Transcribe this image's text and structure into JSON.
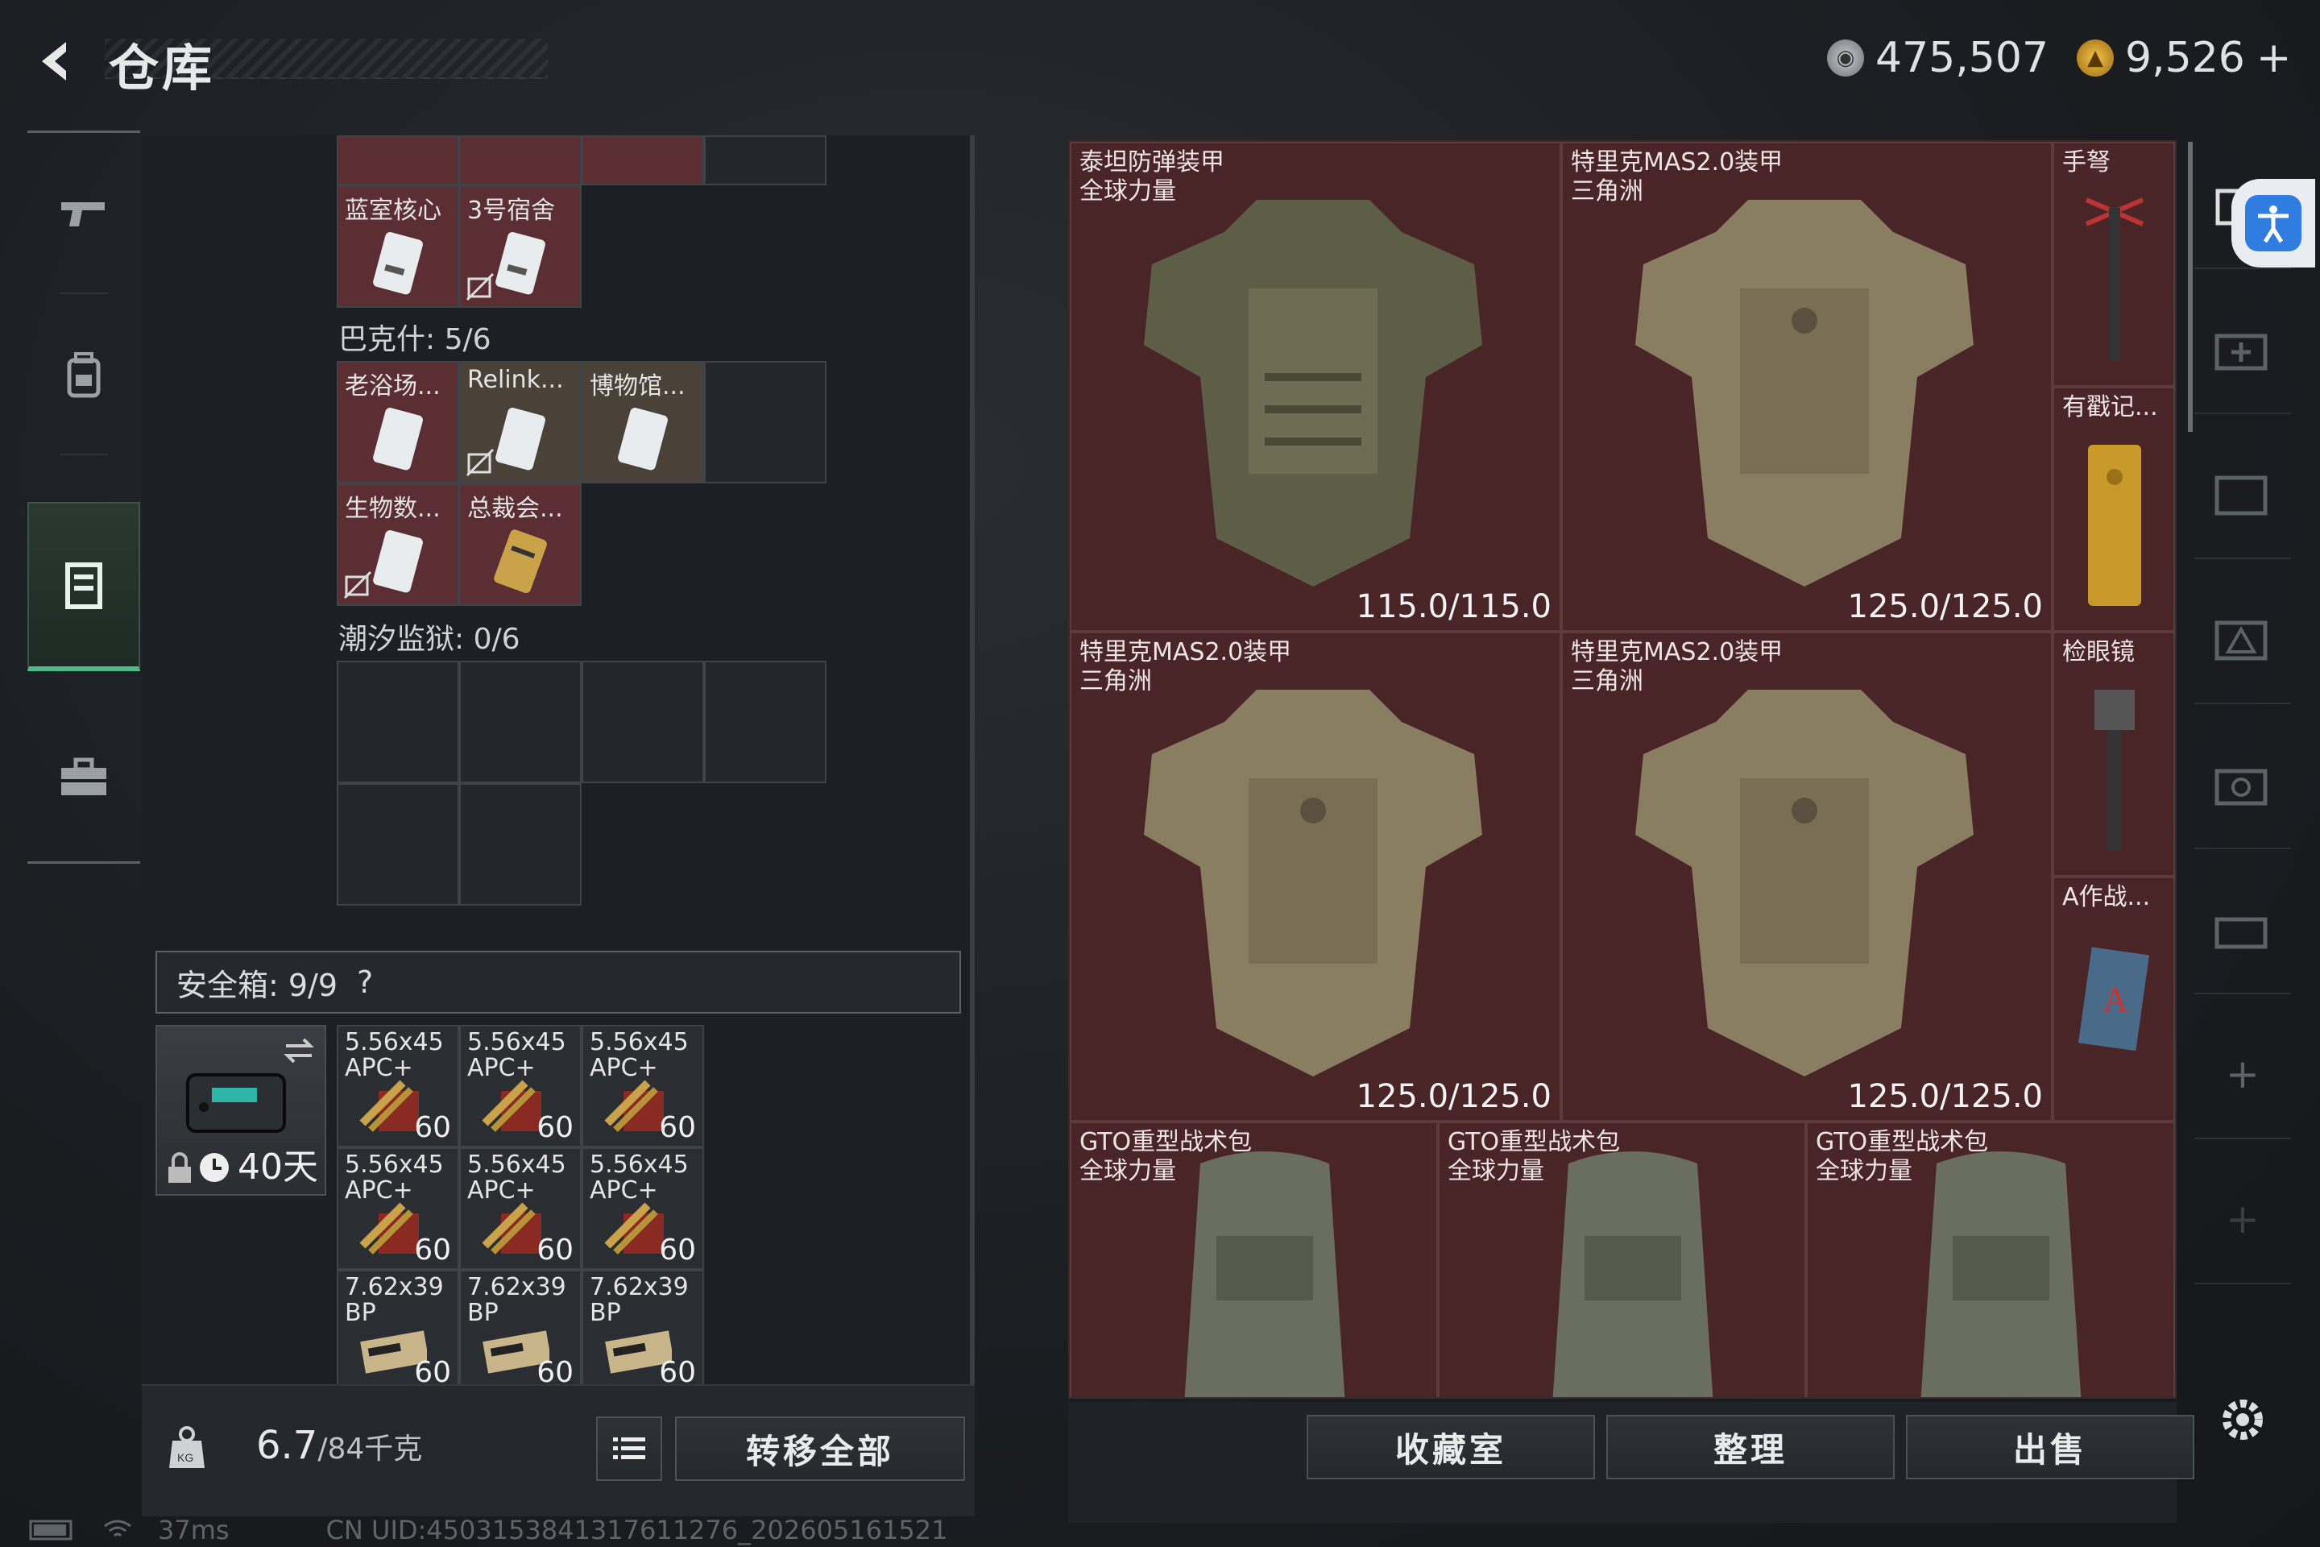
{
  "header": {
    "title": "仓库",
    "currency1": "475,507",
    "currency2": "9,526",
    "plus": "+"
  },
  "left": {
    "top_row_labels": [
      "蓝室核心",
      "3号宿舍"
    ],
    "section1": "巴克什: 5/6",
    "sec1_items": [
      "老浴场...",
      "Relink...",
      "博物馆...",
      "生物数...",
      "总裁会..."
    ],
    "section2": "潮汐监狱: 0/6",
    "safe_label": "安全箱: 9/9",
    "safe_q": "?",
    "safe_days": "40天",
    "ammo": [
      {
        "l1": "5.56x45",
        "l2": "APC+",
        "n": "60"
      },
      {
        "l1": "5.56x45",
        "l2": "APC+",
        "n": "60"
      },
      {
        "l1": "5.56x45",
        "l2": "APC+",
        "n": "60"
      },
      {
        "l1": "5.56x45",
        "l2": "APC+",
        "n": "60"
      },
      {
        "l1": "5.56x45",
        "l2": "APC+",
        "n": "60"
      },
      {
        "l1": "5.56x45",
        "l2": "APC+",
        "n": "60"
      },
      {
        "l1": "7.62x39",
        "l2": "BP",
        "n": "60"
      },
      {
        "l1": "7.62x39",
        "l2": "BP",
        "n": "60"
      },
      {
        "l1": "7.62x39",
        "l2": "BP",
        "n": "60"
      }
    ],
    "weight": "6.7",
    "weight_cap": "/84千克",
    "transfer_label": "转移全部"
  },
  "right": {
    "armors": [
      {
        "name": "泰坦防弹装甲",
        "sub": "全球力量",
        "dur": "115.0/115.0"
      },
      {
        "name": "特里克MAS2.0装甲",
        "sub": "三角洲",
        "dur": "125.0/125.0"
      },
      {
        "name": "特里克MAS2.0装甲",
        "sub": "三角洲",
        "dur": "125.0/125.0"
      },
      {
        "name": "特里克MAS2.0装甲",
        "sub": "三角洲",
        "dur": "125.0/125.0"
      }
    ],
    "small": [
      "手弩",
      "有戳记...",
      "检眼镜",
      "A作战..."
    ],
    "bags": [
      {
        "name": "GTO重型战术包",
        "sub": "全球力量"
      },
      {
        "name": "GTO重型战术包",
        "sub": "全球力量"
      },
      {
        "name": "GTO重型战术包",
        "sub": "全球力量"
      }
    ],
    "buttons": [
      "收藏室",
      "整理",
      "出售"
    ]
  },
  "status": {
    "ping": "37ms",
    "uid": "CN UID:4503153841317611276_202605161521"
  },
  "colors": {
    "accent": "#4fb98a",
    "cell_red": "#4a2528",
    "a11y": "#2f7de1"
  }
}
